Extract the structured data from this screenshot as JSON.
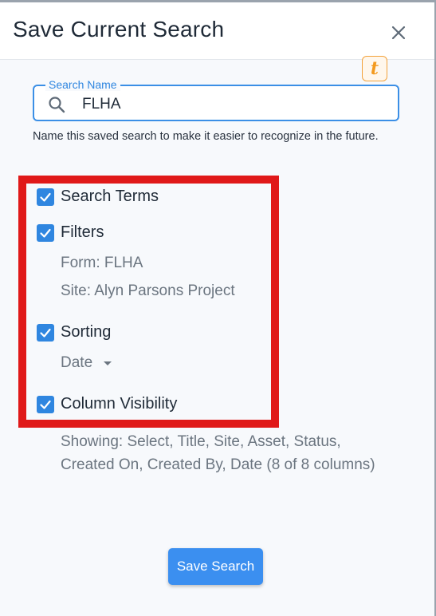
{
  "dialog": {
    "title": "Save Current Search",
    "close_icon": "close-icon",
    "badge_letter": "t"
  },
  "search_field": {
    "label": "Search Name",
    "value": "FLHA",
    "icon": "search-icon"
  },
  "helper_text": "Name this saved search to make it easier to recognize in the future.",
  "options": {
    "search_terms": {
      "label": "Search Terms",
      "checked": true
    },
    "filters": {
      "label": "Filters",
      "checked": true,
      "details": [
        "Form: FLHA",
        "Site: Alyn Parsons Project"
      ]
    },
    "sorting": {
      "label": "Sorting",
      "checked": true,
      "selected": "Date"
    },
    "column_visibility": {
      "label": "Column Visibility",
      "checked": true,
      "summary": "Showing: Select, Title, Site, Asset, Status, Created On, Created By, Date (8 of 8 columns)"
    }
  },
  "save_button": "Save Search",
  "colors": {
    "accent": "#2f86e0",
    "highlight_border": "#e01919",
    "badge": "#f39a1f"
  }
}
